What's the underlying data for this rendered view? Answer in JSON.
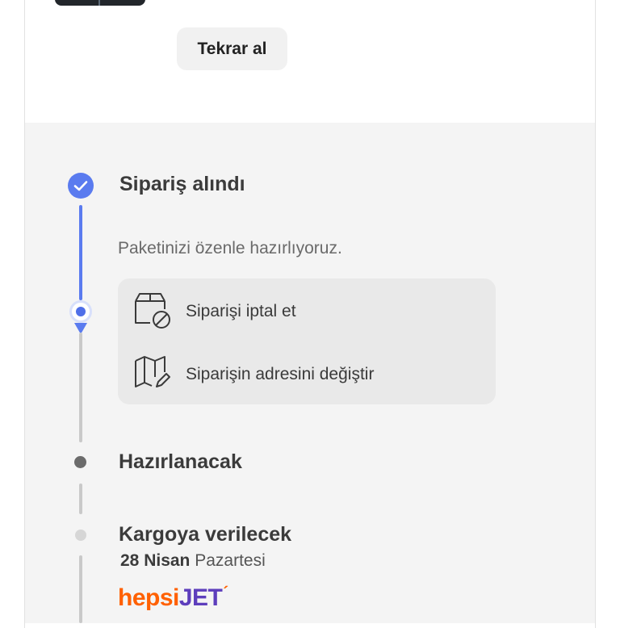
{
  "order": {
    "reorder_label": "Tekrar al"
  },
  "colors": {
    "accent": "#5a7bef",
    "brand_orange": "#ff6000",
    "brand_purple": "#5d3ebc"
  },
  "timeline": {
    "step_received": {
      "title": "Sipariş alındı",
      "description": "Paketinizi özenle hazırlıyoruz.",
      "icon": "check-icon"
    },
    "actions": [
      {
        "label": "Siparişi iptal et",
        "icon": "box-cancel-icon"
      },
      {
        "label": "Siparişin adresini değiştir",
        "icon": "map-edit-icon"
      }
    ],
    "step_preparing": {
      "title": "Hazırlanacak"
    },
    "step_shipping": {
      "title": "Kargoya verilecek",
      "date_bold": "28 Nisan",
      "date_rest": "Pazartesi",
      "carrier_part1": "hepsi",
      "carrier_part2": "JET"
    }
  }
}
